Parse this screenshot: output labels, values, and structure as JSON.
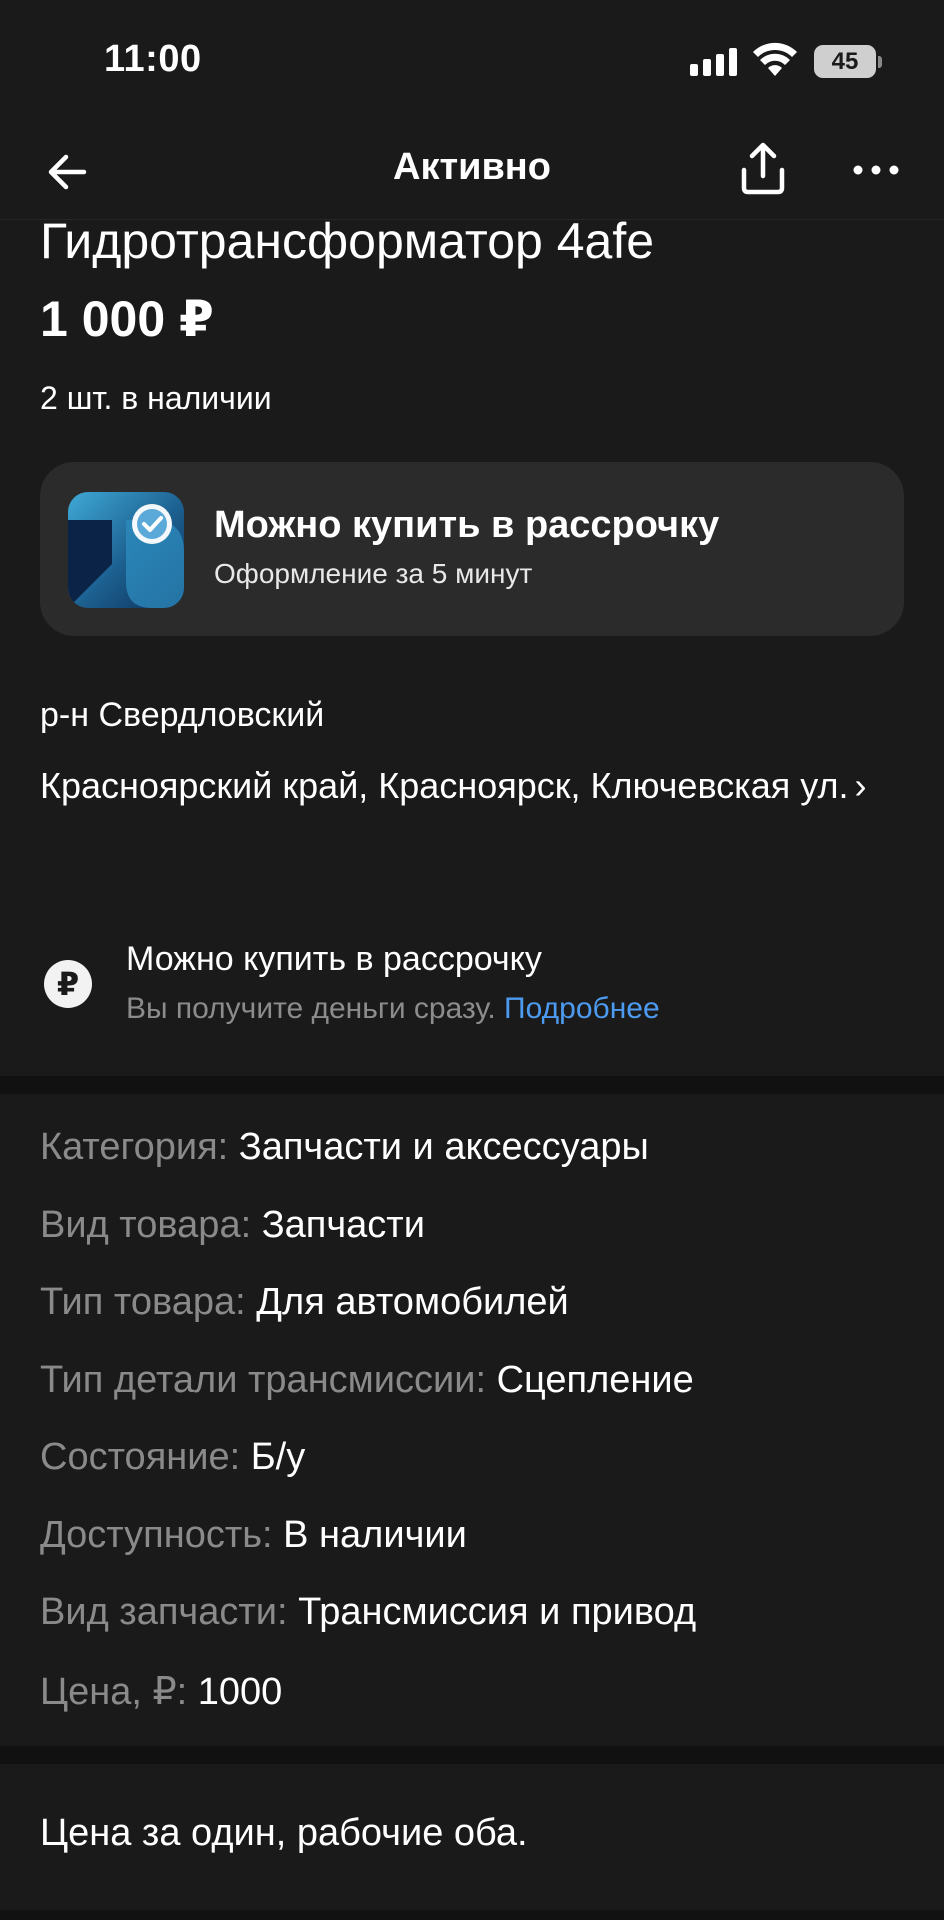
{
  "status_bar": {
    "time": "11:00",
    "battery": "45"
  },
  "nav": {
    "title": "Активно"
  },
  "listing": {
    "title": "Гидротрансформатор 4afe",
    "price": "1 000 ₽",
    "stock": "2 шт. в наличии"
  },
  "promo": {
    "title": "Можно купить в рассрочку",
    "subtitle": "Оформление за 5 минут"
  },
  "location": {
    "district": "р-н Свердловский",
    "address": "Красноярский край, Красноярск, Ключевская ул.",
    "arrow": "›"
  },
  "installment": {
    "icon_glyph": "₽",
    "title": "Можно купить в рассрочку",
    "subtitle": "Вы получите деньги сразу.",
    "link": "Подробнее"
  },
  "params": [
    {
      "label": "Категория:",
      "value": "Запчасти и аксессуары"
    },
    {
      "label": "Вид товара:",
      "value": "Запчасти"
    },
    {
      "label": "Тип товара:",
      "value": "Для автомобилей"
    },
    {
      "label": "Тип детали трансмиссии:",
      "value": "Сцепление"
    },
    {
      "label": "Состояние:",
      "value": "Б/у"
    },
    {
      "label": "Доступность:",
      "value": "В наличии"
    },
    {
      "label": "Вид запчасти:",
      "value": "Трансмиссия и привод"
    },
    {
      "label": "Цена, ₽:",
      "value": "1000"
    }
  ],
  "description": "Цена за один, рабочие оба.",
  "colors": {
    "background": "#1a1a1a",
    "card": "#2b2b2b",
    "link": "#4d9bf0",
    "muted": "#8a8a8a"
  },
  "icons": [
    "back-arrow-icon",
    "share-icon",
    "more-icon",
    "installment-app-icon",
    "ruble-icon",
    "chevron-right-icon",
    "signal-icon",
    "wifi-icon",
    "battery-icon"
  ]
}
